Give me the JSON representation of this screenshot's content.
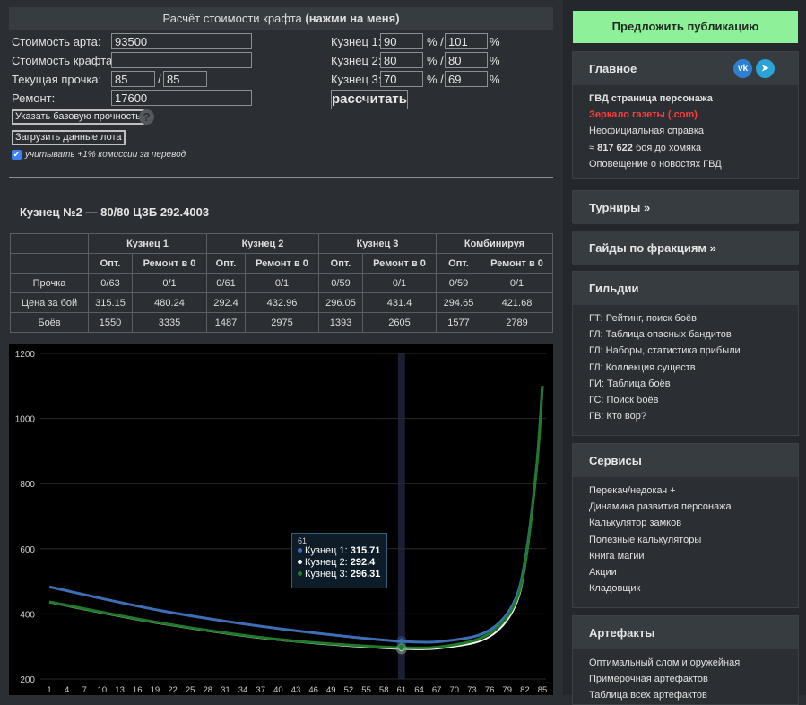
{
  "calc": {
    "header_prefix": "Расчёт стоимости крафта",
    "header_bold": "(нажми на меня)",
    "art_cost_label": "Стоимость арта:",
    "art_cost_value": "93500",
    "craft_cost_label": "Стоимость крафта:",
    "craft_cost_value": "",
    "durability_label": "Текущая прочка:",
    "durability_cur": "85",
    "durability_sep": "/",
    "durability_max": "85",
    "repair_label": "Ремонт:",
    "repair_value": "17600",
    "base_durability_button": "Указать базовую прочность",
    "help_icon": "?",
    "load_lot_button": "Загрузить данные лота",
    "commission_checkbox_label": "учитывать +1% комиссии за перевод",
    "smiths": [
      {
        "label": "Кузнец 1:",
        "pct": "90",
        "sep": "% /",
        "max": "101",
        "unit": "%"
      },
      {
        "label": "Кузнец 2:",
        "pct": "80",
        "sep": "% /",
        "max": "80",
        "unit": "%"
      },
      {
        "label": "Кузнец 3:",
        "pct": "70",
        "sep": "% /",
        "max": "69",
        "unit": "%"
      }
    ],
    "calculate_button": "рассчитать"
  },
  "result_title": "Кузнец №2 — 80/80 ЦЗБ 292.4003",
  "table": {
    "groups": [
      "Кузнец 1",
      "Кузнец 2",
      "Кузнец 3",
      "Комбинируя"
    ],
    "subheaders": [
      "Опт.",
      "Ремонт в 0"
    ],
    "rows": [
      {
        "label": "Прочка",
        "cells": [
          "0/63",
          "0/1",
          "0/61",
          "0/1",
          "0/59",
          "0/1",
          "0/59",
          "0/1"
        ]
      },
      {
        "label": "Цена за бой",
        "cells": [
          "315.15",
          "480.24",
          "292.4",
          "432.96",
          "296.05",
          "431.4",
          "294.65",
          "421.68"
        ]
      },
      {
        "label": "Боёв",
        "cells": [
          "1550",
          "3335",
          "1487",
          "2975",
          "1393",
          "2605",
          "1577",
          "2789"
        ]
      }
    ]
  },
  "chart_data": {
    "type": "line",
    "ylim": [
      200,
      1200
    ],
    "y_ticks": [
      "200",
      "400",
      "600",
      "800",
      "1000",
      "1200"
    ],
    "x_ticks": [
      "1",
      "4",
      "7",
      "10",
      "13",
      "16",
      "19",
      "22",
      "25",
      "28",
      "31",
      "34",
      "37",
      "40",
      "43",
      "46",
      "49",
      "52",
      "55",
      "58",
      "61",
      "64",
      "67",
      "70",
      "73",
      "76",
      "79",
      "82",
      "85"
    ],
    "xlim": [
      1,
      85
    ],
    "grid": true,
    "series": [
      {
        "name": "Кузнец 1",
        "color": "#3d6fb6",
        "x": [
          1,
          20,
          40,
          61,
          70,
          76,
          80,
          82,
          84,
          85
        ],
        "y": [
          483,
          410,
          355,
          315.71,
          320,
          350,
          430,
          560,
          850,
          1100
        ]
      },
      {
        "name": "Кузнец 2",
        "color": "#f2f2f2",
        "x": [
          1,
          20,
          40,
          61,
          70,
          76,
          80,
          82,
          84,
          85
        ],
        "y": [
          435,
          370,
          320,
          292.4,
          300,
          330,
          410,
          540,
          840,
          1100
        ]
      },
      {
        "name": "Кузнец 3",
        "color": "#1f7a2a",
        "x": [
          1,
          20,
          40,
          61,
          70,
          76,
          80,
          82,
          84,
          85
        ],
        "y": [
          437,
          372,
          322,
          296.31,
          305,
          340,
          420,
          550,
          845,
          1100
        ]
      }
    ],
    "highlight_x": 61,
    "tooltip": {
      "title": "61",
      "rows": [
        {
          "name": "Кузнец 1:",
          "value": "315.71",
          "color": "#3d6fb6"
        },
        {
          "name": "Кузнец 2:",
          "value": "292.4",
          "color": "#ffffff"
        },
        {
          "name": "Кузнец 3:",
          "value": "296.31",
          "color": "#1f7a2a"
        }
      ]
    }
  },
  "sidebar": {
    "suggest_button": "Предложить публикацию",
    "main": {
      "title": "Главное",
      "vk_icon_text": "vk",
      "telegram_icon_text": "➤",
      "items": [
        {
          "text": "ГВД страница персонажа",
          "style": "bold"
        },
        {
          "text": "Зеркало газеты (.com)",
          "style": "red"
        },
        {
          "text": "Неофициальная справка",
          "style": ""
        }
      ],
      "counter_prefix": "≈",
      "counter_value": "817 622",
      "counter_suffix": "боя до хомяка",
      "last_item": "Оповещение о новостях ГВД"
    },
    "tournaments": "Турниры »",
    "guides": "Гайды по фракциям »",
    "guilds": {
      "title": "Гильдии",
      "items": [
        "ГТ: Рейтинг, поиск боёв",
        "ГЛ: Таблица опасных бандитов",
        "ГЛ: Наборы, статистика прибыли",
        "ГЛ: Коллекция существ",
        "ГИ: Таблица боёв",
        "ГС: Поиск боёв",
        "ГВ: Кто вор?"
      ]
    },
    "services": {
      "title": "Сервисы",
      "items": [
        "Перекач/недокач +",
        "Динамика развития персонажа",
        "Калькулятор замков",
        "Полезные калькуляторы",
        "Книга магии",
        "Акции",
        "Кладовщик"
      ]
    },
    "artifacts": {
      "title": "Артефакты",
      "items": [
        "Оптимальный слом и оружейная",
        "Примерочная артефактов",
        "Таблица всех артефактов"
      ]
    }
  }
}
